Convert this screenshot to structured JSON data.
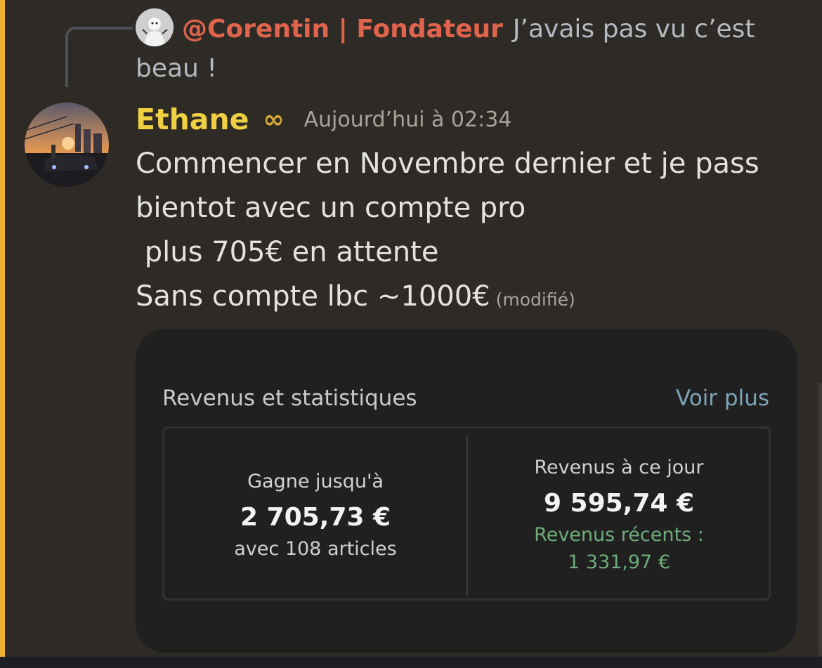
{
  "reply": {
    "author": "@Corentin | Fondateur",
    "text": "J’avais pas vu c’est beau !"
  },
  "message": {
    "author": "Ethane",
    "badge": "∞",
    "timestamp": "Aujourd’hui à 02:34",
    "lines": [
      "Commencer en Novembre dernier et je pass",
      "bientot avec un compte pro",
      " plus 705€ en attente",
      "Sans compte lbc ~1000€"
    ],
    "edited": "(modifié)"
  },
  "card": {
    "title": "Revenus et statistiques",
    "link": "Voir plus",
    "left": {
      "label": "Gagne jusqu'à",
      "value": "2 705,73 €",
      "sub": "avec 108 articles"
    },
    "right": {
      "label": "Revenus à ce jour",
      "value": "9 595,74 €",
      "recent_label": "Revenus récents :",
      "recent_value": "1 331,97 €"
    }
  },
  "colors": {
    "background": "#2e2a25",
    "highlight_bar": "#f0b232",
    "reply_author": "#e0644c",
    "author": "#f0d043",
    "link": "#7fa3b8",
    "recent_green": "#6fab79"
  }
}
